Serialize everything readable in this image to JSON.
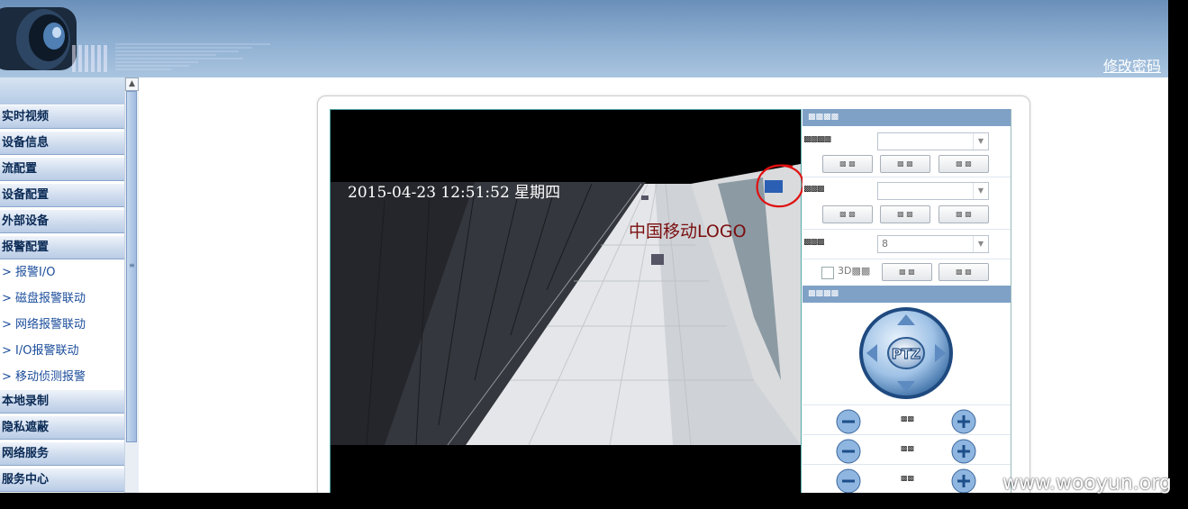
{
  "header": {
    "change_password_label": "修改密码"
  },
  "sidebar": {
    "items": [
      {
        "label": "实时视频"
      },
      {
        "label": "设备信息"
      },
      {
        "label": "流配置"
      },
      {
        "label": "设备配置"
      },
      {
        "label": "外部设备"
      },
      {
        "label": "报警配置"
      }
    ],
    "alarm_sub_items": [
      {
        "label": "> 报警I/O"
      },
      {
        "label": "> 磁盘报警联动"
      },
      {
        "label": "> 网络报警联动"
      },
      {
        "label": "> I/O报警联动"
      },
      {
        "label": "> 移动侦测报警"
      }
    ],
    "items_after": [
      {
        "label": "本地录制"
      },
      {
        "label": "隐私遮蔽"
      },
      {
        "label": "网络服务"
      },
      {
        "label": "服务中心"
      }
    ]
  },
  "video": {
    "timestamp": "2015-04-23 12:51:52 星期四",
    "annotation": "中国移动LOGO"
  },
  "controls": {
    "section1_title": "▩▩▩▩",
    "row1_label": "▩▩▩▩",
    "row1_value": "",
    "row2_label": "▩▩▩",
    "row2_value": "",
    "row3_label": "▩▩▩",
    "row3_value": "8",
    "btn_glyph": "▩ ▩",
    "checkbox_label": "3D▩▩",
    "section2_title": "▩▩▩▩",
    "ptz_label": "PTZ",
    "zoom_label": "▩▩"
  },
  "watermark": "www.wooyun.org",
  "colors": {
    "header": "#8fb0d2",
    "menu_text": "#0a2a55",
    "sub_menu_text": "#1b4d9b",
    "section_head": "#7fa1c6",
    "annotation": "#7a0f0f",
    "circle": "#e01010"
  }
}
